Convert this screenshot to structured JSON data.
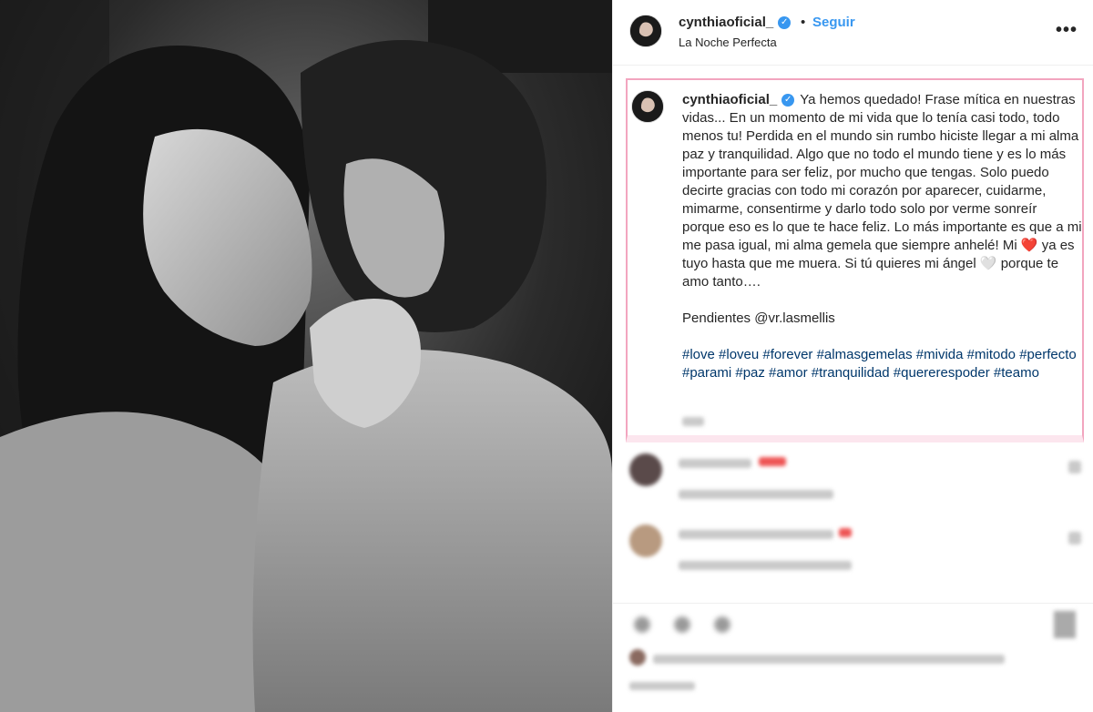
{
  "header": {
    "username": "cynthiaoficial_",
    "verified_badge": "✓",
    "separator": "•",
    "follow_label": "Seguir",
    "location": "La Noche Perfecta",
    "more_label": "•••"
  },
  "caption": {
    "username": "cynthiaoficial_",
    "verified_badge": "✓",
    "text": "Ya hemos quedado! Frase mítica en nuestras vidas... En un momento de mi vida que lo tenía casi todo, todo menos tu! Perdida en el mundo sin rumbo hiciste llegar a mi alma paz y tranquilidad. Algo que no todo el mundo tiene y es lo más importante para ser feliz, por mucho que tengas. Solo puedo decirte gracias con todo mi corazón por aparecer, cuidarme, mimarme, consentirme y darlo todo solo por verme sonreír porque eso es lo que te hace feliz. Lo más importante es que a mi me pasa igual, mi alma gemela que siempre anhelé! Mi ❤️ ya es tuyo hasta que me muera. Si tú quieres mi ángel 🤍 porque te amo tanto….",
    "credits": "Pendientes @vr.lasmellis",
    "hashtags": "#love #loveu #forever #almasgemelas #mivida #mitodo #perfecto #parami #paz #amor #tranquilidad #quererespoder #teamo"
  },
  "colors": {
    "accent": "#3897f0",
    "highlight_border": "#f2a5bf"
  }
}
